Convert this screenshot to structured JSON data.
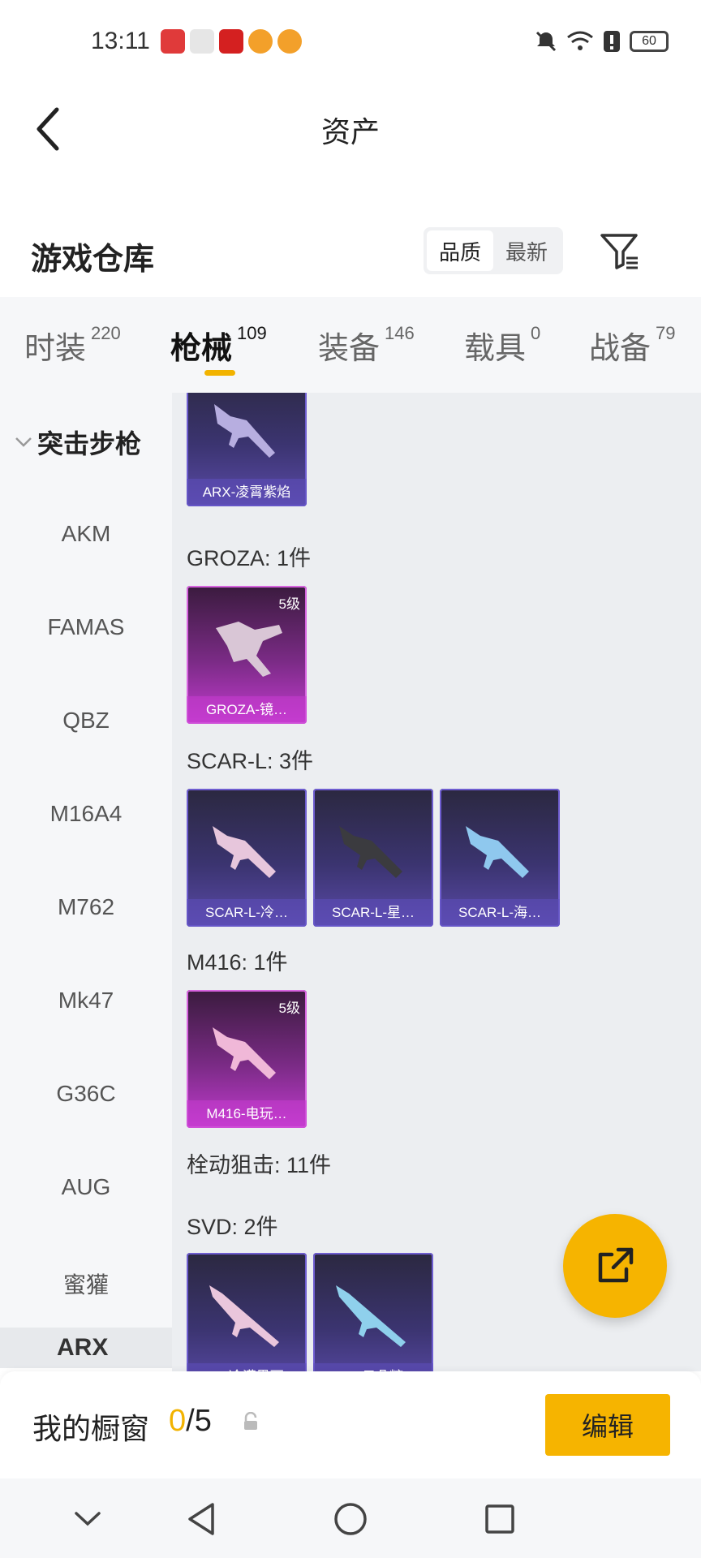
{
  "status_bar": {
    "time": "13:11",
    "battery": "60"
  },
  "header": {
    "title": "资产",
    "back_icon": "chevron-left-icon"
  },
  "warehouse": {
    "title": "游戏仓库",
    "sort_options": [
      "品质",
      "最新"
    ],
    "active_sort": "品质",
    "filter_icon": "filter-icon"
  },
  "tabs": [
    {
      "label": "时装",
      "count": "220"
    },
    {
      "label": "枪械",
      "count": "109"
    },
    {
      "label": "装备",
      "count": "146"
    },
    {
      "label": "载具",
      "count": "0"
    },
    {
      "label": "战备",
      "count": "79"
    }
  ],
  "active_tab": "枪械",
  "sidebar": {
    "group": "突击步枪",
    "items": [
      "AKM",
      "FAMAS",
      "QBZ",
      "M16A4",
      "M762",
      "Mk47",
      "G36C",
      "AUG",
      "蜜獾"
    ],
    "next_partial": "ARX"
  },
  "content": {
    "groups": [
      {
        "label": "",
        "cards": [
          {
            "name": "ARX-凌霄紫焰",
            "rarity": "purple",
            "level": ""
          }
        ]
      },
      {
        "label": "GROZA: 1件",
        "cards": [
          {
            "name": "GROZA-镜…",
            "rarity": "pink",
            "level": "5级"
          }
        ]
      },
      {
        "label": "SCAR-L: 3件",
        "cards": [
          {
            "name": "SCAR-L-冷…",
            "rarity": "purple",
            "level": ""
          },
          {
            "name": "SCAR-L-星…",
            "rarity": "purple",
            "level": ""
          },
          {
            "name": "SCAR-L-海…",
            "rarity": "purple",
            "level": ""
          }
        ]
      },
      {
        "label": "M416: 1件",
        "cards": [
          {
            "name": "M416-电玩…",
            "rarity": "pink",
            "level": "5级"
          }
        ]
      },
      {
        "label": "栓动狙击: 11件",
        "cards": []
      },
      {
        "label": "SVD: 2件",
        "cards": [
          {
            "name": "SVD-冷漠黑丽…",
            "rarity": "purple",
            "level": ""
          },
          {
            "name": "SVD-云朵糖…",
            "rarity": "purple",
            "level": ""
          }
        ]
      }
    ]
  },
  "fab": {
    "icon": "share-external-icon"
  },
  "showcase": {
    "label": "我的橱窗",
    "current": "0",
    "total": "/5",
    "edit_label": "编辑"
  },
  "colors": {
    "accent": "#f6b400",
    "purple_card": "#3b3470",
    "pink_card": "#7b2b86"
  }
}
